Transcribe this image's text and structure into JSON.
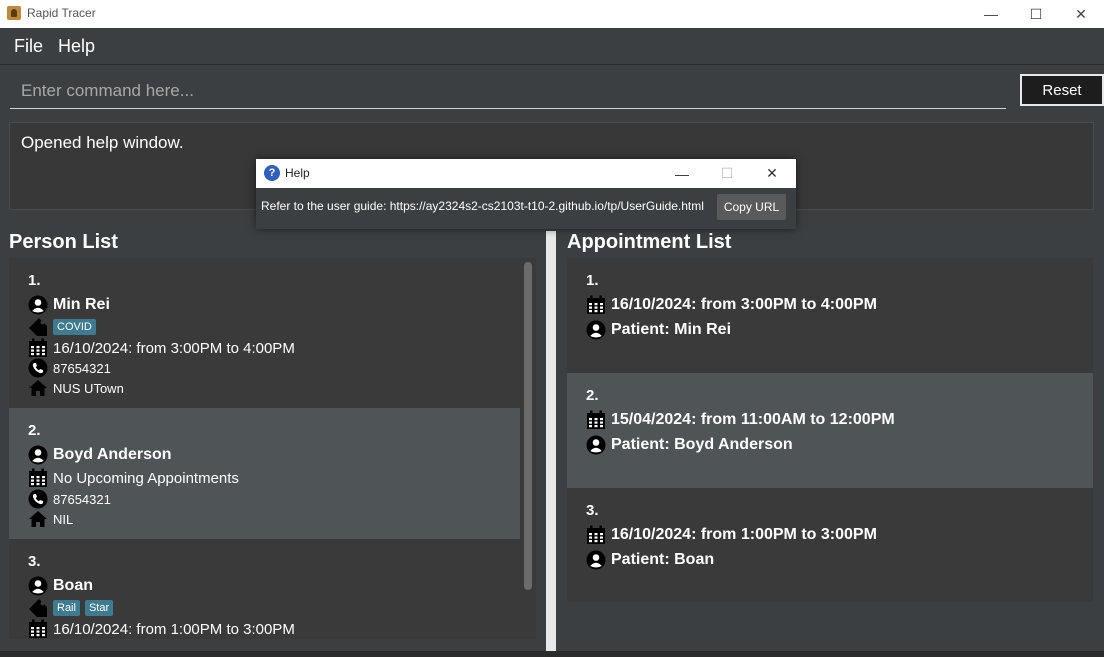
{
  "window": {
    "title": "Rapid Tracer",
    "minimize": "—",
    "maximize": "☐",
    "close": "✕"
  },
  "menu": {
    "file": "File",
    "help": "Help"
  },
  "command": {
    "placeholder": "Enter command here...",
    "reset_label": "Reset"
  },
  "result": {
    "text": "Opened help window."
  },
  "help_dialog": {
    "title": "Help",
    "icon": "?",
    "minimize": "—",
    "maximize": "☐",
    "close": "✕",
    "message": "Refer to the user guide: https://ay2324s2-cs2103t-t10-2.github.io/tp/UserGuide.html",
    "copy_label": "Copy URL"
  },
  "person_list": {
    "title": "Person List",
    "persons": [
      {
        "index": "1.",
        "name": "Min Rei",
        "tags": [
          "COVID"
        ],
        "appointment": "16/10/2024: from 3:00PM to 4:00PM",
        "phone": "87654321",
        "address": "NUS UTown"
      },
      {
        "index": "2.",
        "name": "Boyd Anderson",
        "tags": [],
        "appointment": "No Upcoming Appointments",
        "phone": "87654321",
        "address": "NIL"
      },
      {
        "index": "3.",
        "name": "Boan",
        "tags": [
          "Rail",
          "Star"
        ],
        "appointment": "16/10/2024: from 1:00PM to 3:00PM",
        "phone": "",
        "address": ""
      }
    ]
  },
  "appointment_list": {
    "title": "Appointment List",
    "appointments": [
      {
        "index": "1.",
        "time": "16/10/2024: from 3:00PM to 4:00PM",
        "patient": "Patient: Min Rei"
      },
      {
        "index": "2.",
        "time": "15/04/2024: from 11:00AM to 12:00PM",
        "patient": "Patient: Boyd Anderson"
      },
      {
        "index": "3.",
        "time": "16/10/2024: from 1:00PM to 3:00PM",
        "patient": "Patient: Boan"
      }
    ]
  }
}
